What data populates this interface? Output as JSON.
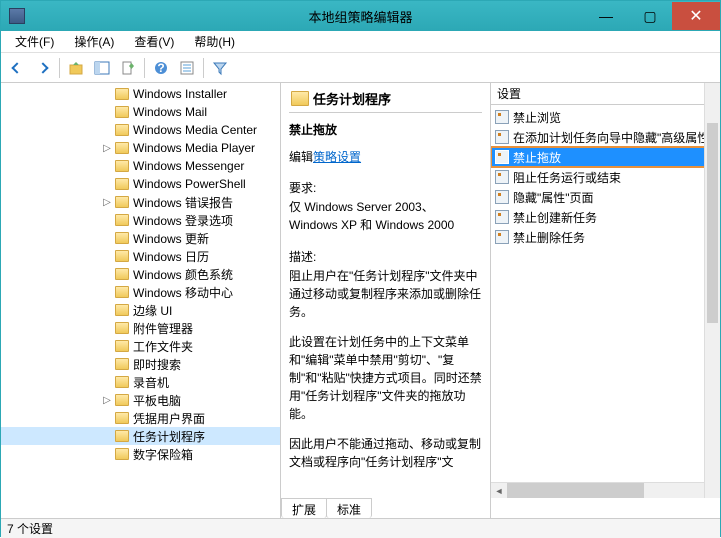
{
  "window": {
    "title": "本地组策略编辑器"
  },
  "menu": {
    "file": "文件(F)",
    "action": "操作(A)",
    "view": "查看(V)",
    "help": "帮助(H)"
  },
  "tree": {
    "items": [
      {
        "label": "Windows Installer",
        "exp": false
      },
      {
        "label": "Windows Mail",
        "exp": false
      },
      {
        "label": "Windows Media Center",
        "exp": false
      },
      {
        "label": "Windows Media Player",
        "exp": true
      },
      {
        "label": "Windows Messenger",
        "exp": false
      },
      {
        "label": "Windows PowerShell",
        "exp": false
      },
      {
        "label": "Windows 错误报告",
        "exp": true
      },
      {
        "label": "Windows 登录选项",
        "exp": false
      },
      {
        "label": "Windows 更新",
        "exp": false
      },
      {
        "label": "Windows 日历",
        "exp": false
      },
      {
        "label": "Windows 颜色系统",
        "exp": false
      },
      {
        "label": "Windows 移动中心",
        "exp": false
      },
      {
        "label": "边缘 UI",
        "exp": false
      },
      {
        "label": "附件管理器",
        "exp": false
      },
      {
        "label": "工作文件夹",
        "exp": false
      },
      {
        "label": "即时搜索",
        "exp": false
      },
      {
        "label": "录音机",
        "exp": false
      },
      {
        "label": "平板电脑",
        "exp": true
      },
      {
        "label": "凭据用户界面",
        "exp": false
      },
      {
        "label": "任务计划程序",
        "exp": false,
        "sel": true
      },
      {
        "label": "数字保险箱",
        "exp": false
      }
    ]
  },
  "detail": {
    "heading": "任务计划程序",
    "subtitle": "禁止拖放",
    "edit_prefix": "编辑",
    "edit_link": "策略设置",
    "req_label": "要求:",
    "req_text": "仅 Windows Server 2003、Windows XP 和 Windows 2000",
    "desc_label": "描述:",
    "desc1": "阻止用户在\"任务计划程序\"文件夹中通过移动或复制程序来添加或删除任务。",
    "desc2": "此设置在计划任务中的上下文菜单和\"编辑\"菜单中禁用\"剪切\"、\"复制\"和\"粘贴\"快捷方式项目。同时还禁用\"任务计划程序\"文件夹的拖放功能。",
    "desc3": "因此用户不能通过拖动、移动或复制文档或程序向\"任务计划程序\"文"
  },
  "list": {
    "header": "设置",
    "items": [
      {
        "label": "禁止浏览"
      },
      {
        "label": "在添加计划任务向导中隐藏\"高级属性"
      },
      {
        "label": "禁止拖放",
        "sel": true
      },
      {
        "label": "阻止任务运行或结束"
      },
      {
        "label": "隐藏\"属性\"页面"
      },
      {
        "label": "禁止创建新任务"
      },
      {
        "label": "禁止删除任务"
      }
    ]
  },
  "tabs": {
    "extended": "扩展",
    "standard": "标准"
  },
  "status": {
    "text": "7 个设置"
  }
}
